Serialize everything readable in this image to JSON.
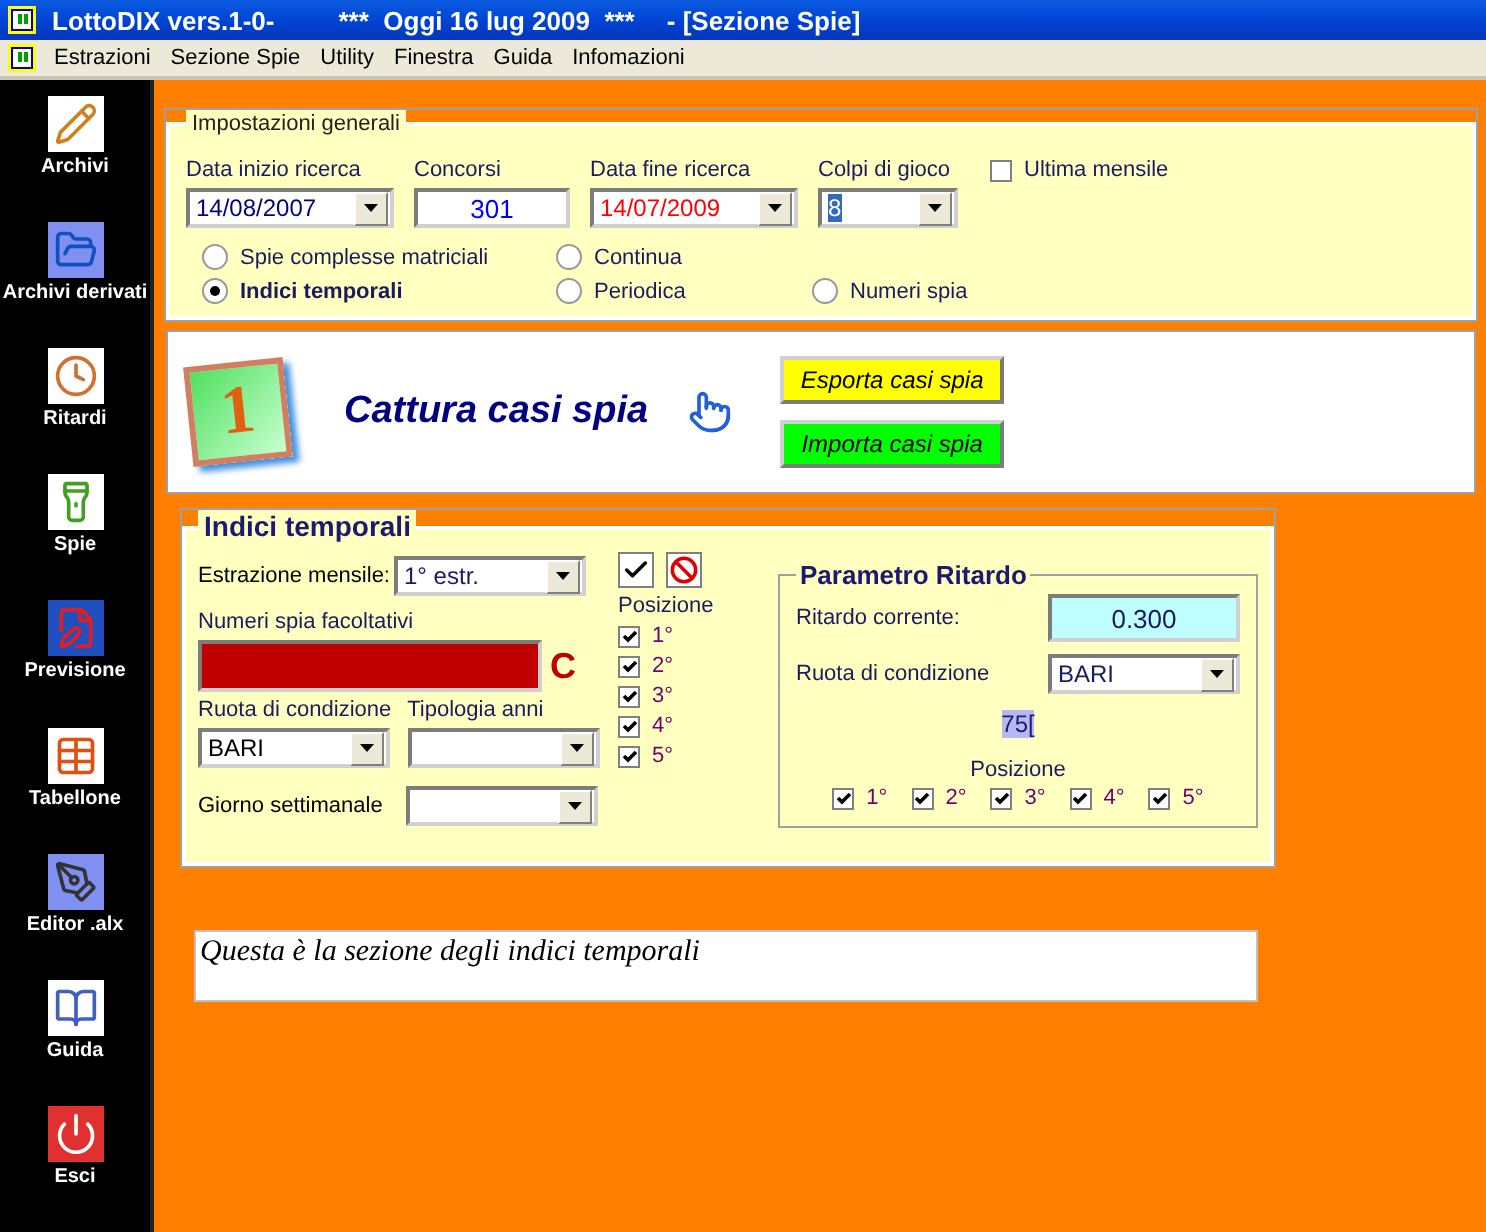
{
  "window": {
    "title": "LottoDIX vers.1-0-",
    "banner": "***  Oggi 16 lug 2009  ***",
    "section": "- [Sezione Spie]"
  },
  "menu": [
    "Estrazioni",
    "Sezione Spie",
    "Utility",
    "Finestra",
    "Guida",
    "Infomazioni"
  ],
  "sidebar": {
    "items": [
      "Archivi",
      "Archivi derivati",
      "Ritardi",
      "Spie",
      "Previsione",
      "Tabellone",
      "Editor .alx",
      "Guida",
      "Esci"
    ]
  },
  "general": {
    "legend": "Impostazioni generali",
    "fields": [
      {
        "label": "Data inizio ricerca",
        "value": "14/08/2007",
        "kind": "dropdown",
        "color": "#000080",
        "focused": false
      },
      {
        "label": "Concorsi",
        "value": "301",
        "kind": "input",
        "color": "#0000ff",
        "focused": false
      },
      {
        "label": "Data fine ricerca",
        "value": "14/07/2009",
        "kind": "dropdown",
        "color": "#ff0000",
        "focused": false
      },
      {
        "label": "Colpi di gioco",
        "value": "8",
        "kind": "dropdown",
        "focused": true
      }
    ],
    "ultima": {
      "label": "Ultima mensile",
      "checked": false
    },
    "radios": [
      {
        "label": "Spie complesse matriciali",
        "selected": false
      },
      {
        "label": "Continua",
        "selected": false
      },
      {
        "label": "Indici temporali",
        "selected": true
      },
      {
        "label": "Periodica",
        "selected": false
      },
      {
        "label": "Numeri spia",
        "selected": false
      }
    ]
  },
  "capture": {
    "badge": "1",
    "title": "Cattura casi spia",
    "buttons": [
      {
        "label": "Esporta casi spia",
        "color": "#ffff00"
      },
      {
        "label": "Importa casi spia",
        "color": "#00ff00"
      }
    ]
  },
  "indici": {
    "legend": "Indici temporali",
    "estrazione_label": "Estrazione mensile:",
    "estrazione_value": "1° estr.",
    "numeri_label": "Numeri spia facoltativi",
    "numeri_letter": "C",
    "ruota_label": "Ruota di condizione",
    "ruota_value": "BARI",
    "tipologia_label": "Tipologia anni",
    "giorno_label": "Giorno settimanale",
    "posizione_label": "Posizione",
    "positions": [
      {
        "label": "1°",
        "checked": true
      },
      {
        "label": "2°",
        "checked": true
      },
      {
        "label": "3°",
        "checked": true
      },
      {
        "label": "4°",
        "checked": true
      },
      {
        "label": "5°",
        "checked": true
      }
    ]
  },
  "ritardo": {
    "legend": "Parametro Ritardo",
    "corrente_label": "Ritardo corrente:",
    "corrente_value": "0.300",
    "ruota_label": "Ruota di condizione",
    "ruota_value": "BARI",
    "marker": "75[",
    "posizione_label": "Posizione",
    "positions": [
      {
        "label": "1°",
        "checked": true
      },
      {
        "label": "2°",
        "checked": true
      },
      {
        "label": "3°",
        "checked": true
      },
      {
        "label": "4°",
        "checked": true
      },
      {
        "label": "5°",
        "checked": true
      }
    ]
  },
  "note": "Questa è la sezione degli indici temporali"
}
